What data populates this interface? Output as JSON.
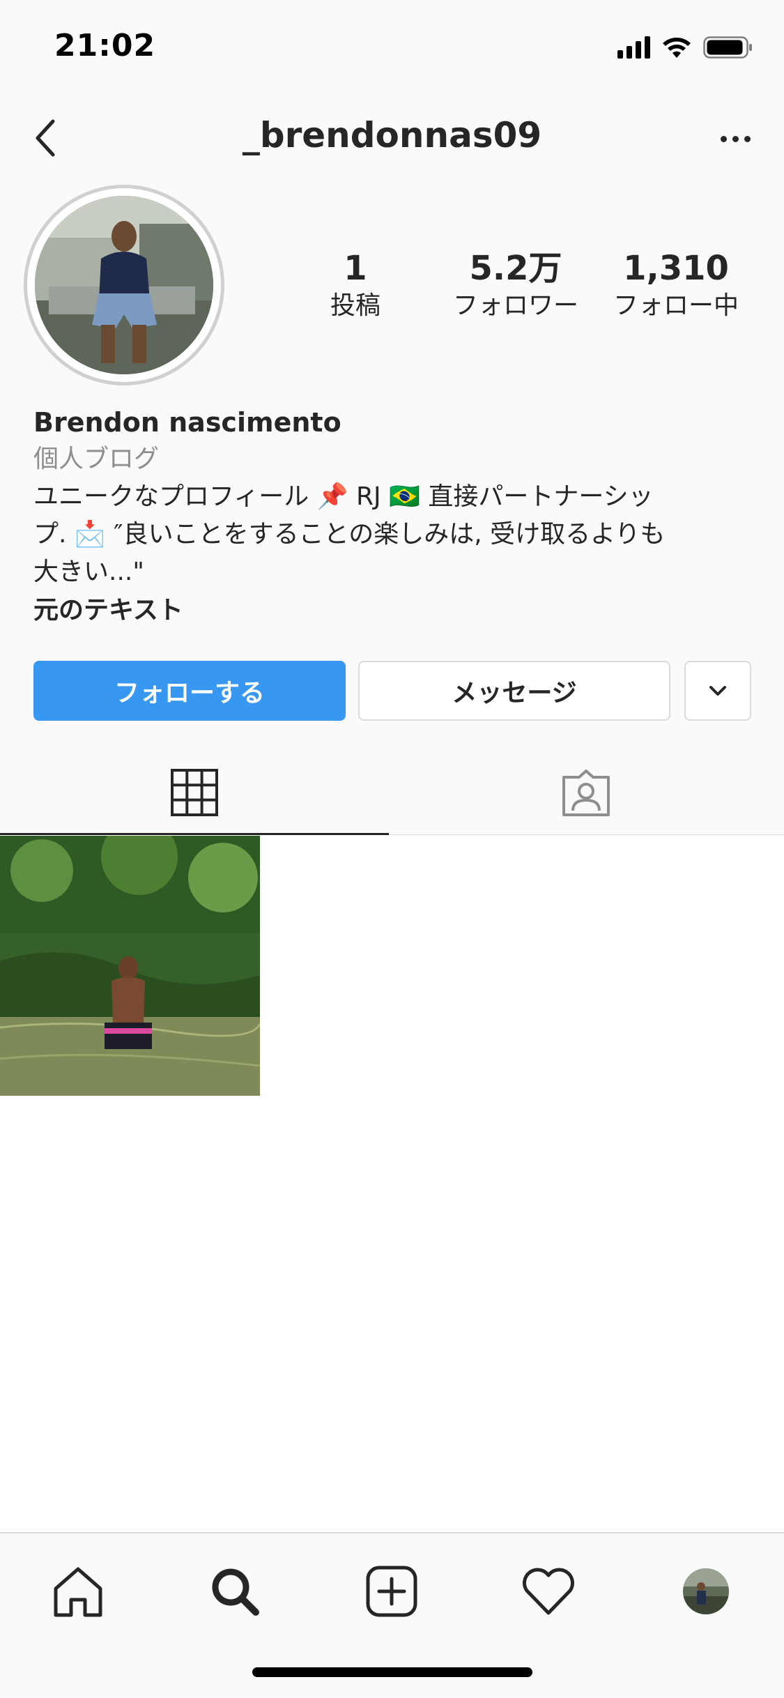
{
  "status_bar": {
    "time": "21:02",
    "icons": [
      "signal-icon",
      "wifi-icon",
      "battery-icon"
    ]
  },
  "header": {
    "username": "_brendonnas09",
    "back_icon": "chevron-left-icon",
    "more_icon": "more-horizontal-icon"
  },
  "profile": {
    "stats": [
      {
        "value": "1",
        "label": "投稿"
      },
      {
        "value": "5.2万",
        "label": "フォロワー"
      },
      {
        "value": "1,310",
        "label": "フォロー中"
      }
    ]
  },
  "bio": {
    "name": "Brendon nascimento",
    "category": "個人ブログ",
    "line1": "ユニークなプロフィール 📌 RJ 🇧🇷 直接パートナーシッ",
    "line2": "プ. 📩 ″良いことをすることの楽しみは, 受け取るよりも",
    "line3": "大きい...\"",
    "link": "元のテキスト"
  },
  "buttons": {
    "follow": "フォローする",
    "message": "メッセージ",
    "dropdown_icon": "chevron-down-icon"
  },
  "tabs": [
    {
      "icon": "grid-icon",
      "active": true
    },
    {
      "icon": "tagged-person-icon",
      "active": false
    }
  ],
  "colors": {
    "follow_button": "#3897f0",
    "text": "#262626",
    "secondary_text": "#8e8e8e",
    "border": "#dbdbdb"
  },
  "bottom_nav": {
    "items": [
      "home-icon",
      "search-icon",
      "add-post-icon",
      "activity-heart-icon",
      "profile-avatar-icon"
    ],
    "active": "search-icon"
  }
}
